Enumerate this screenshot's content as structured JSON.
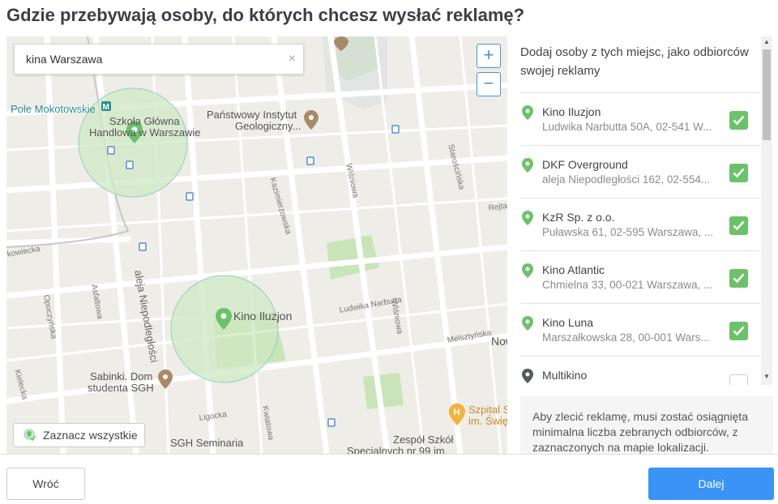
{
  "page": {
    "title": "Gdzie przebywają osoby, do których chcesz wysłać reklamę?"
  },
  "map": {
    "search": {
      "value": "kina Warszawa",
      "clear_symbol": "×"
    },
    "zoom_in": "+",
    "zoom_out": "−",
    "select_all_label": "Zaznacz wszystkie",
    "labels": {
      "pole_mokotowskie": "Pole Mokotowskie",
      "szkola_line1": "Szkoła Główna",
      "szkola_line2": "Handlowa w Warszawie",
      "instytut_line1": "Państwowy Instytut",
      "instytut_line2": "Geologiczny...",
      "kino_iluzjon": "Kino Iluzjon",
      "sabinki_line1": "Sabinki. Dom",
      "sabinki_line2": "studenta SGH",
      "sgh_seminaria": "SGH Seminaria",
      "zespol_line1": "Zespół Szkół",
      "zespol_line2": "Specjalnych nr 99 im.",
      "szpital_line1": "Szpital S",
      "szpital_line2": "im. Świę",
      "now": "Now"
    },
    "streets": {
      "kazimierzowska": "Kazimierzowska",
      "wisniowa1": "Wiśniowa",
      "wisniowa2": "Wiśniowa",
      "starościńska": "Starościńska",
      "rejtana": "Rejta",
      "ludwika_narbutta": "Ludwika Narbutta",
      "melsztynska": "Melsztyńska",
      "aleja_niepodleglosci": "aleja Niepodległości",
      "asfaltowa": "Asfaltowa",
      "opoczynska": "Opoczyńska",
      "kielecka": "Kielecka",
      "ligocka": "Ligocka",
      "kwiatowa": "Kwiatowa",
      "rakowiecka": "kowiecka"
    },
    "colors": {
      "circle_fill": "#cfe8c4",
      "circle_stroke": "#8fcfc4",
      "pin_green": "#6cc26a",
      "pin_brown": "#a88a6a"
    }
  },
  "panel": {
    "header": "Dodaj osoby z tych miejsc, jako odbiorców swojej reklamy",
    "items": [
      {
        "name": "Kino Iluzjon",
        "address": "Ludwika Narbutta 50A, 02-541 W...",
        "checked": true
      },
      {
        "name": "DKF Overground",
        "address": "aleja Niepodległości 162, 02-554...",
        "checked": true
      },
      {
        "name": "KzR Sp. z o.o.",
        "address": "Puławska 61, 02-595 Warszawa, ...",
        "checked": true
      },
      {
        "name": "Kino Atlantic",
        "address": "Chmielna 33, 00-021 Warszawa, ...",
        "checked": true
      },
      {
        "name": "Kino Luna",
        "address": "Marszałkowska 28, 00-001 Wars...",
        "checked": true
      },
      {
        "name": "Multikino",
        "address": "",
        "checked": false
      }
    ],
    "notice": "Aby zlecić reklamę, musi zostać osiągnięta minimalna liczba zebranych odbiorców, z zaznaczonych na mapie lokalizacji."
  },
  "footer": {
    "back_label": "Wróć",
    "next_label": "Dalej"
  },
  "colors": {
    "accent": "#3a94f5",
    "check_green": "#6cc26a",
    "title": "#3b3f45"
  }
}
